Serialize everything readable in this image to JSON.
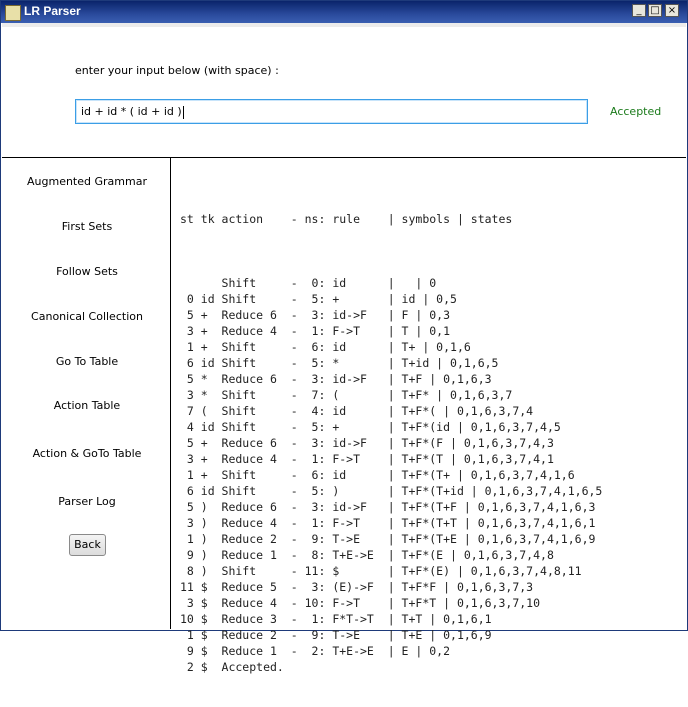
{
  "window": {
    "title": "LR Parser",
    "controls": {
      "minimize": "_",
      "maximize": "□",
      "close": "×"
    }
  },
  "input_section": {
    "prompt": "enter your input below (with space) :",
    "value": "id + id * ( id + id )",
    "status": "Accepted",
    "status_color": "#1a7a1a"
  },
  "sidebar": {
    "items": [
      {
        "label": "Augmented Grammar"
      },
      {
        "label": "First Sets"
      },
      {
        "label": "Follow Sets"
      },
      {
        "label": "Canonical Collection"
      },
      {
        "label": "Go To Table"
      },
      {
        "label": "Action Table"
      },
      {
        "label": "Action & GoTo Table"
      },
      {
        "label": "Parser Log"
      }
    ],
    "back_label": "Back"
  },
  "log": {
    "header": "st tk action    - ns: rule    | symbols | states",
    "rows": [
      "",
      "      Shift     -  0: id      |   | 0",
      " 0 id Shift     -  5: +       | id | 0,5",
      " 5 +  Reduce 6  -  3: id->F   | F | 0,3",
      " 3 +  Reduce 4  -  1: F->T    | T | 0,1",
      " 1 +  Shift     -  6: id      | T+ | 0,1,6",
      " 6 id Shift     -  5: *       | T+id | 0,1,6,5",
      " 5 *  Reduce 6  -  3: id->F   | T+F | 0,1,6,3",
      " 3 *  Shift     -  7: (       | T+F* | 0,1,6,3,7",
      " 7 (  Shift     -  4: id      | T+F*( | 0,1,6,3,7,4",
      " 4 id Shift     -  5: +       | T+F*(id | 0,1,6,3,7,4,5",
      " 5 +  Reduce 6  -  3: id->F   | T+F*(F | 0,1,6,3,7,4,3",
      " 3 +  Reduce 4  -  1: F->T    | T+F*(T | 0,1,6,3,7,4,1",
      " 1 +  Shift     -  6: id      | T+F*(T+ | 0,1,6,3,7,4,1,6",
      " 6 id Shift     -  5: )       | T+F*(T+id | 0,1,6,3,7,4,1,6,5",
      " 5 )  Reduce 6  -  3: id->F   | T+F*(T+F | 0,1,6,3,7,4,1,6,3",
      " 3 )  Reduce 4  -  1: F->T    | T+F*(T+T | 0,1,6,3,7,4,1,6,1",
      " 1 )  Reduce 2  -  9: T->E    | T+F*(T+E | 0,1,6,3,7,4,1,6,9",
      " 9 )  Reduce 1  -  8: T+E->E  | T+F*(E | 0,1,6,3,7,4,8",
      " 8 )  Shift     - 11: $       | T+F*(E) | 0,1,6,3,7,4,8,11",
      "11 $  Reduce 5  -  3: (E)->F  | T+F*F | 0,1,6,3,7,3",
      " 3 $  Reduce 4  - 10: F->T    | T+F*T | 0,1,6,3,7,10",
      "10 $  Reduce 3  -  1: F*T->T  | T+T | 0,1,6,1",
      " 1 $  Reduce 2  -  9: T->E    | T+E | 0,1,6,9",
      " 9 $  Reduce 1  -  2: T+E->E  | E | 0,2",
      " 2 $  Accepted."
    ]
  }
}
